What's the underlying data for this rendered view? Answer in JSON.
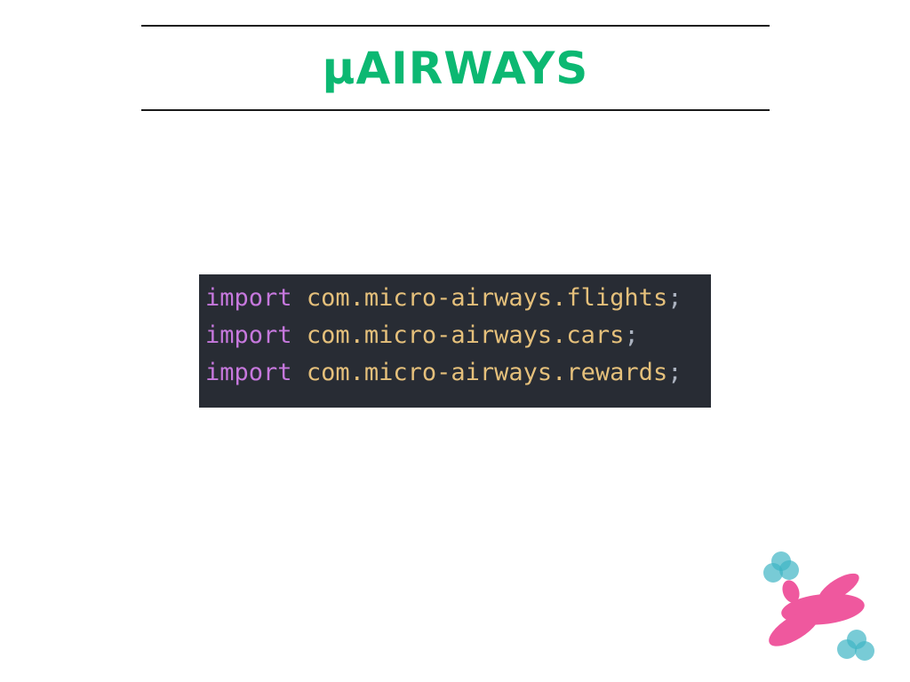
{
  "slide": {
    "title": "µAIRWAYS",
    "title_color": "#0cb872"
  },
  "code": {
    "background": "#282c34",
    "keyword_color": "#c678dd",
    "module_color": "#e5c07b",
    "punct_color": "#abb2bf",
    "lines": [
      {
        "keyword": "import",
        "module": "com.micro-airways.flights",
        "punct": ";"
      },
      {
        "keyword": "import",
        "module": "com.micro-airways.cars",
        "punct": ";"
      },
      {
        "keyword": "import",
        "module": "com.micro-airways.rewards",
        "punct": ";"
      }
    ]
  },
  "logo": {
    "icon": "airplane-icon",
    "plane_color": "#ec2f86",
    "cloud_color": "#3fb5c5"
  }
}
